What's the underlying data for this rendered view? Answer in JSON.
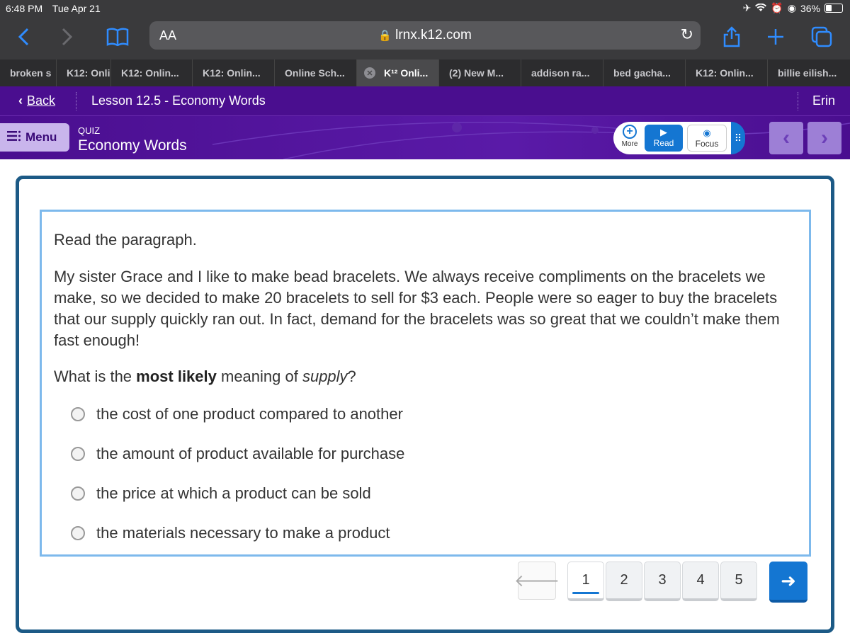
{
  "status_bar": {
    "time": "6:48 PM",
    "date": "Tue Apr 21",
    "battery": "36%",
    "battery_level": 0.36
  },
  "browser": {
    "text_size_label": "AA",
    "url": "lrnx.k12.com",
    "tabs": [
      {
        "label": "broken s"
      },
      {
        "label": "K12: Onli"
      },
      {
        "label": "K12: Onlin..."
      },
      {
        "label": "K12: Onlin..."
      },
      {
        "label": "Online Sch..."
      },
      {
        "label": "K¹² Onli..."
      },
      {
        "label": "(2) New M..."
      },
      {
        "label": "addison ra..."
      },
      {
        "label": "bed gacha..."
      },
      {
        "label": "K12: Onlin..."
      },
      {
        "label": "billie eilish..."
      }
    ]
  },
  "lesson": {
    "back_label": "Back",
    "title": "Lesson 12.5 - Economy Words",
    "user": "Erin"
  },
  "quiz_header": {
    "menu_label": "Menu",
    "type_label": "QUIZ",
    "title": "Economy Words",
    "more_label": "More",
    "read_label": "Read",
    "focus_label": "Focus"
  },
  "question": {
    "instruction": "Read the paragraph.",
    "passage": "My sister Grace and I like to make bead bracelets. We always receive compliments on the bracelets we make, so we decided to make 20 bracelets to sell for $3 each. People were so eager to buy the bracelets that our supply quickly ran out. In fact, demand for the bracelets was so great that we couldn’t make them fast enough!",
    "prompt_start": "What is the ",
    "prompt_bold": "most likely",
    "prompt_middle": " meaning of ",
    "prompt_italic": "supply",
    "prompt_end": "?",
    "options": [
      "the cost of one product compared to another",
      "the amount of product available for purchase",
      "the price at which a product can be sold",
      "the materials necessary to make a product"
    ]
  },
  "pager": {
    "pages": [
      "1",
      "2",
      "3",
      "4",
      "5"
    ],
    "current": "1"
  }
}
